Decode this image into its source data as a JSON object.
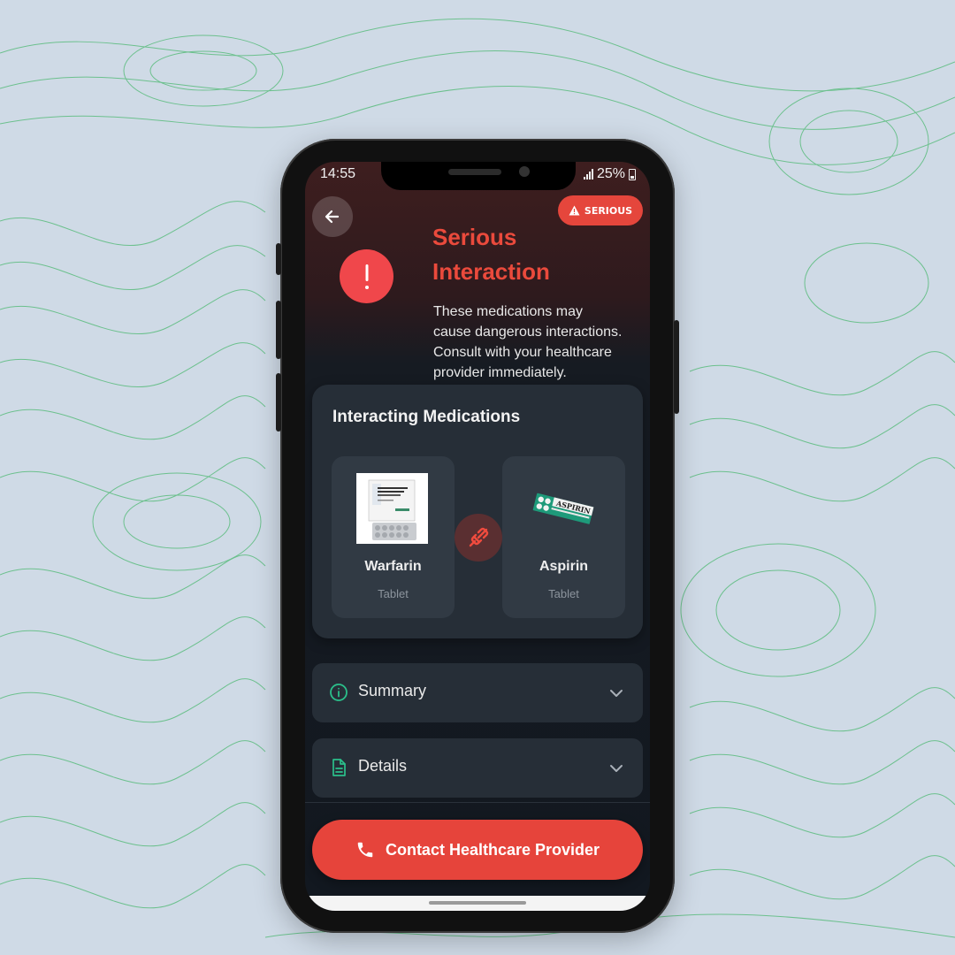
{
  "status_bar": {
    "time": "14:55",
    "battery": "25%"
  },
  "header": {
    "back_icon": "arrow-left-icon",
    "badge_label": "SERIOUS",
    "badge_icon": "warning-triangle-icon",
    "alert_icon": "exclamation-icon",
    "title_line1": "Serious",
    "title_line2": "Interaction",
    "description": "These medications may cause dangerous interactions. Consult with your healthcare provider immediately."
  },
  "interacting_card": {
    "title": "Interacting Medications",
    "link_icon": "broken-link-icon",
    "medications": [
      {
        "name": "Warfarin",
        "form": "Tablet",
        "image": "warfarin-package-image"
      },
      {
        "name": "Aspirin",
        "form": "Tablet",
        "image": "aspirin-package-image"
      }
    ]
  },
  "accordions": [
    {
      "label": "Summary",
      "icon": "info-circle-icon"
    },
    {
      "label": "Details",
      "icon": "document-icon"
    }
  ],
  "cta": {
    "label": "Contact Healthcare Provider",
    "icon": "phone-icon"
  },
  "colors": {
    "accent_red": "#e6443b",
    "accent_teal": "#2bbf8a",
    "background": "#cfdae6",
    "card": "#262e37"
  }
}
